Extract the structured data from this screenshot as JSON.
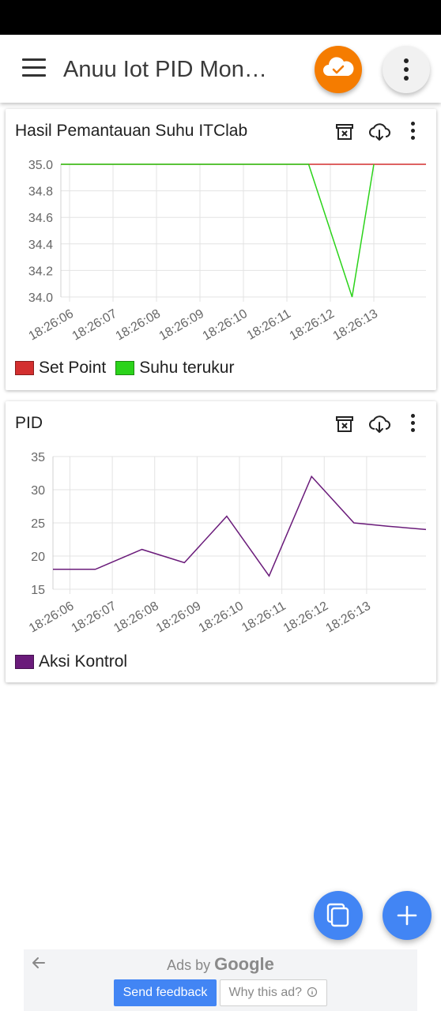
{
  "app": {
    "title": "Anuu Iot PID Mon…",
    "menu_icon": "hamburger-menu-icon",
    "cloud_icon": "cloud-check-icon",
    "more_icon": "more-vertical-icon",
    "accent_color": "#f57c00"
  },
  "cards": {
    "temperature": {
      "title": "Hasil Pemantauan Suhu ITClab",
      "icons": [
        "archive-clear-icon",
        "cloud-download-icon",
        "more-vertical-icon"
      ],
      "legend": [
        {
          "label": "Set Point",
          "color": "#d32f2f"
        },
        {
          "label": "Suhu terukur",
          "color": "#2bd31a"
        }
      ]
    },
    "pid": {
      "title": "PID",
      "icons": [
        "archive-clear-icon",
        "cloud-download-icon",
        "more-vertical-icon"
      ],
      "legend": [
        {
          "label": "Aksi Kontrol",
          "color": "#6a1b7a"
        }
      ]
    }
  },
  "chart_data": [
    {
      "type": "line",
      "title": "Hasil Pemantauan Suhu ITClab",
      "x_ticks": [
        "18:26:06",
        "18:26:07",
        "18:26:08",
        "18:26:09",
        "18:26:10",
        "18:26:11",
        "18:26:12",
        "18:26:13"
      ],
      "y_ticks": [
        "35.0",
        "34.8",
        "34.6",
        "34.4",
        "34.2",
        "34.0"
      ],
      "ylim": [
        34.0,
        35.0
      ],
      "xlim": [
        -0.2,
        8.2
      ],
      "grid": true,
      "legend_position": "bottom-left",
      "series": [
        {
          "name": "Set Point",
          "color": "#d32f2f",
          "x": [
            -0.2,
            8.2
          ],
          "y": [
            35.0,
            35.0
          ]
        },
        {
          "name": "Suhu terukur",
          "color": "#2bd31a",
          "x": [
            -0.2,
            5.5,
            6.5,
            7.0
          ],
          "y": [
            35.0,
            35.0,
            34.0,
            35.0
          ]
        }
      ]
    },
    {
      "type": "line",
      "title": "PID",
      "x_ticks": [
        "18:26:06",
        "18:26:07",
        "18:26:08",
        "18:26:09",
        "18:26:10",
        "18:26:11",
        "18:26:12",
        "18:26:13"
      ],
      "y_ticks": [
        "35",
        "30",
        "25",
        "20",
        "15"
      ],
      "ylim": [
        15,
        35
      ],
      "xlim": [
        -0.4,
        8.4
      ],
      "grid": true,
      "legend_position": "bottom-left",
      "series": [
        {
          "name": "Aksi Kontrol",
          "color": "#6a1b7a",
          "x": [
            -0.4,
            0.6,
            1.7,
            2.7,
            3.7,
            4.7,
            5.7,
            6.7,
            7.5,
            8.4
          ],
          "y": [
            18,
            18,
            21,
            19,
            26,
            17,
            32,
            25,
            24.5,
            24
          ]
        }
      ]
    }
  ],
  "fabs": {
    "copy_icon": "copy-icon",
    "add_icon": "plus-icon"
  },
  "ad": {
    "label_prefix": "Ads by",
    "label_brand": "Google",
    "back_icon": "arrow-back-icon",
    "feedback_label": "Send feedback",
    "why_label": "Why this ad?",
    "info_icon": "info-icon"
  }
}
